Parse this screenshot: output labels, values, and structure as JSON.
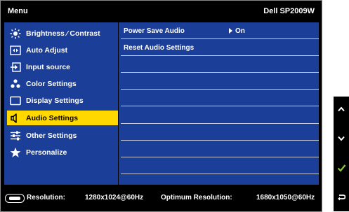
{
  "header": {
    "menu_title": "Menu",
    "model": "Dell SP2009W"
  },
  "sidebar": {
    "items": [
      {
        "label": "Brightness ⁄ Contrast",
        "icon": "brightness-icon"
      },
      {
        "label": "Auto Adjust",
        "icon": "auto-adjust-icon"
      },
      {
        "label": "Input source",
        "icon": "input-source-icon"
      },
      {
        "label": "Color Settings",
        "icon": "color-settings-icon"
      },
      {
        "label": "Display Settings",
        "icon": "display-settings-icon"
      },
      {
        "label": "Audio Settings",
        "icon": "speaker-icon",
        "active": true
      },
      {
        "label": "Other Settings",
        "icon": "sliders-icon"
      },
      {
        "label": "Personalize",
        "icon": "star-icon"
      }
    ]
  },
  "content": {
    "rows": [
      {
        "label": "Power Save Audio",
        "value": "On"
      },
      {
        "label": "Reset Audio Settings",
        "value": ""
      }
    ]
  },
  "footer": {
    "resolution_label": "Resolution:",
    "resolution_value": "1280x1024@60Hz",
    "optimum_label": "Optimum Resolution:",
    "optimum_value": "1680x1050@60Hz"
  },
  "buttons": [
    "up-arrow-icon",
    "down-arrow-icon",
    "checkmark-icon",
    "return-icon"
  ],
  "colors": {
    "osd_background": "#1b3e99",
    "active_highlight": "#ffd800",
    "confirm_green": "#8cc63f"
  }
}
